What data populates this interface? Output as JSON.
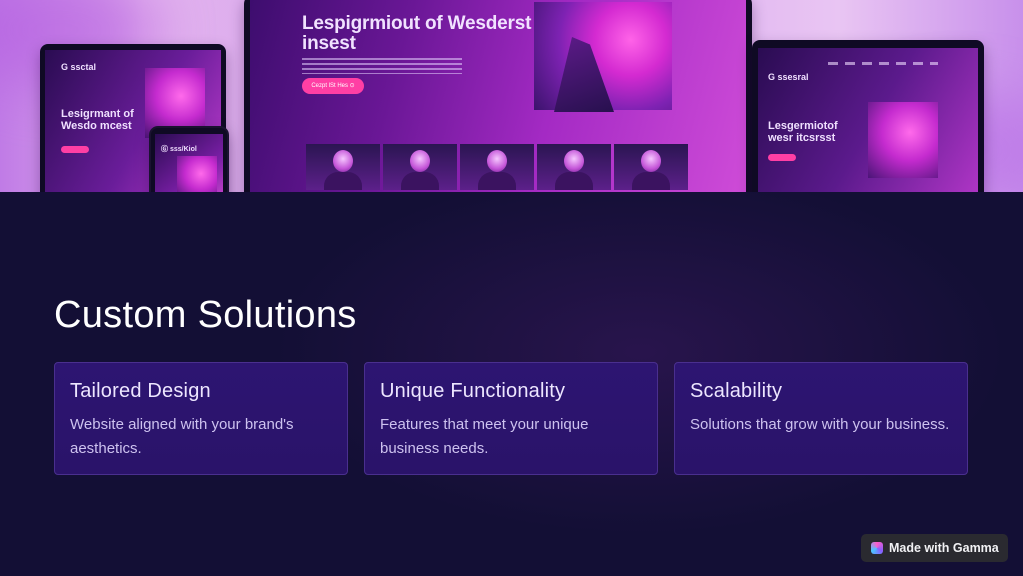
{
  "hero": {
    "title": "Lespigrmiout of Wesderst insest",
    "button": "Cezpt lSt Hes  ⊙",
    "tablet_brand": "G ssctal",
    "tablet_title": "Lesigrmant of Wesdo mcest",
    "phone_brand": "Ⓖ sss/Kiol",
    "laptop_brand": "G ssesral",
    "laptop_title": "Lesgermiotof wesr itcsrsst"
  },
  "main": {
    "title": "Custom Solutions",
    "cards": [
      {
        "title": "Tailored Design",
        "text": "Website aligned with your brand's aesthetics."
      },
      {
        "title": "Unique Functionality",
        "text": "Features that meet your unique business needs."
      },
      {
        "title": "Scalability",
        "text": "Solutions that grow with your business."
      }
    ]
  },
  "badge": {
    "label": "Made with Gamma",
    "icon": "gamma-logo-icon"
  },
  "colors": {
    "background": "#130f35",
    "card": "#2d1572",
    "card_border": "#4a2f8f",
    "accent_pink": "#ff3fa4",
    "badge_bg": "#2a2a30"
  }
}
